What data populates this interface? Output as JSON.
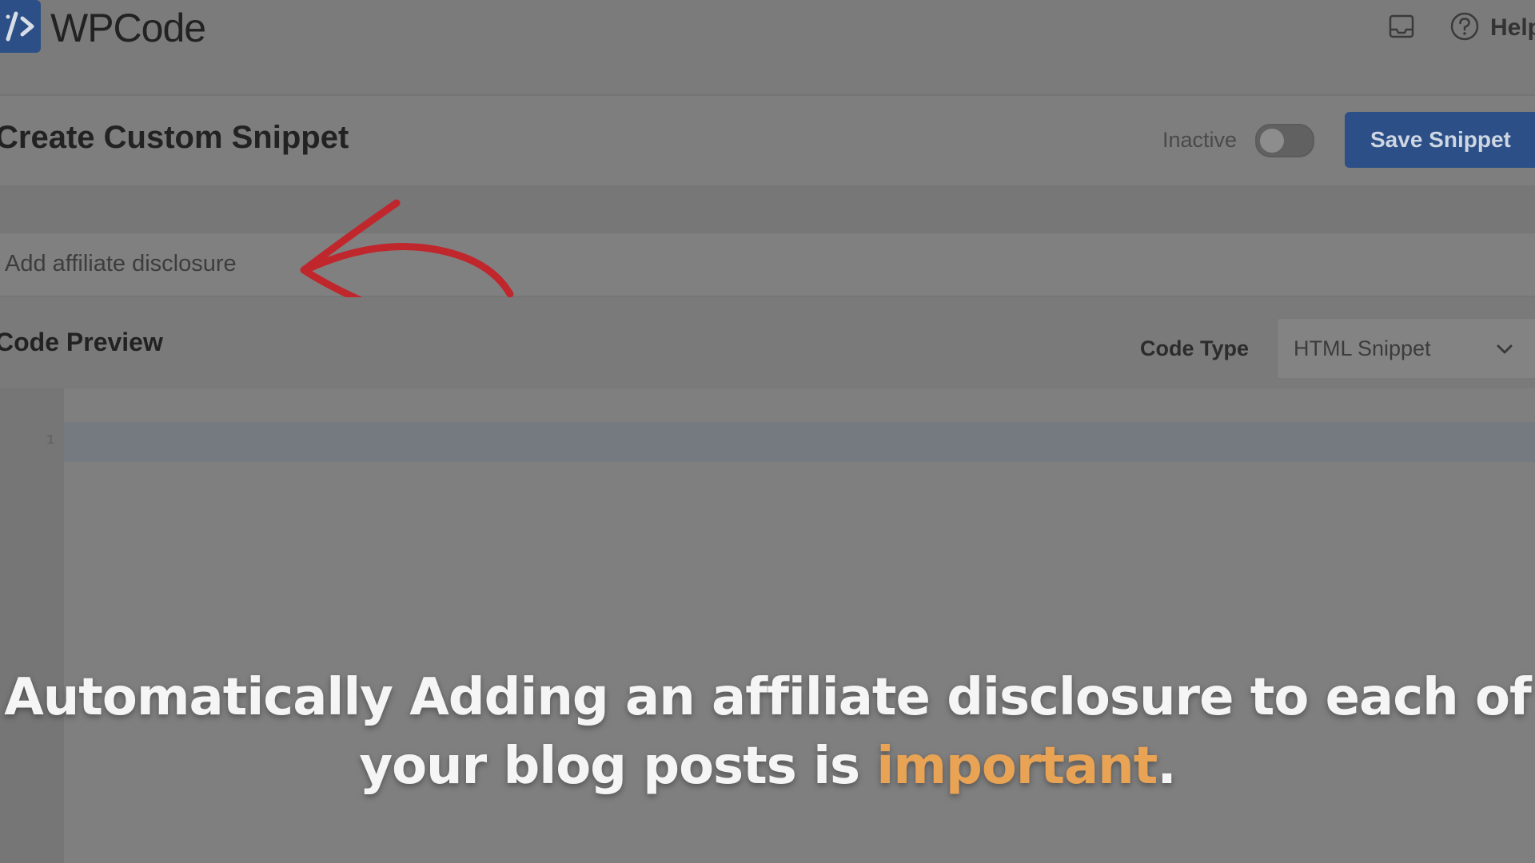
{
  "app": {
    "logo_text": "WPCode",
    "help_label": "Help",
    "icons": [
      "code-bracket-icon",
      "inbox-icon",
      "help-circle-icon",
      "chevron-down-icon",
      "red-arrow-annotation"
    ]
  },
  "header": {
    "page_title": "Create Custom Snippet",
    "status_label": "Inactive",
    "save_label": "Save Snippet",
    "toggle_on": false
  },
  "snippet": {
    "title_value": "Add affiliate disclosure"
  },
  "code": {
    "section_label": "Code Preview",
    "code_type_label": "Code Type",
    "code_type_value": "HTML Snippet",
    "line_number": "1"
  },
  "caption": {
    "text_before": "Automatically Adding an affiliate disclosure to each of your blog posts is ",
    "highlight": "important",
    "text_after": "."
  },
  "colors": {
    "brand": "#2b4f86",
    "annotation": "#c0272d",
    "caption_highlight": "#e8a355"
  }
}
